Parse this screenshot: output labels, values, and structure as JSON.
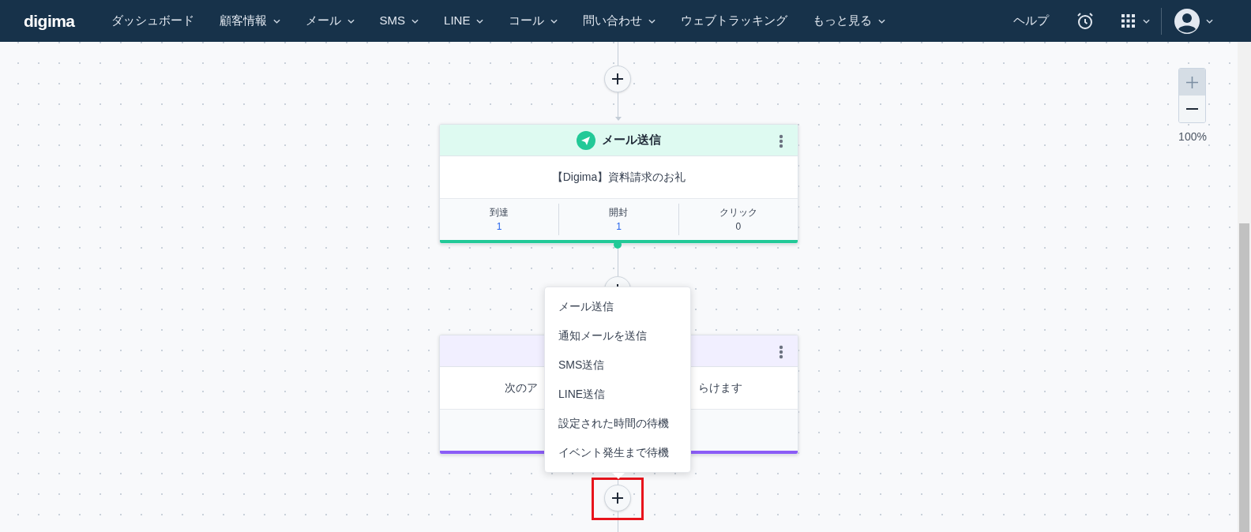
{
  "nav": {
    "logo": "digima",
    "items": [
      {
        "label": "ダッシュボード",
        "has_dropdown": false
      },
      {
        "label": "顧客情報",
        "has_dropdown": true
      },
      {
        "label": "メール",
        "has_dropdown": true
      },
      {
        "label": "SMS",
        "has_dropdown": true
      },
      {
        "label": "LINE",
        "has_dropdown": true
      },
      {
        "label": "コール",
        "has_dropdown": true
      },
      {
        "label": "問い合わせ",
        "has_dropdown": true
      },
      {
        "label": "ウェブトラッキング",
        "has_dropdown": false
      },
      {
        "label": "もっと見る",
        "has_dropdown": true
      }
    ],
    "help": "ヘルプ"
  },
  "nodes": [
    {
      "kind": "mail",
      "title": "メール送信",
      "subject": "【Digima】資料請求のお礼",
      "stats": [
        {
          "label": "到達",
          "value": "1",
          "linked": true
        },
        {
          "label": "開封",
          "value": "1",
          "linked": true
        },
        {
          "label": "クリック",
          "value": "0",
          "linked": false
        }
      ]
    },
    {
      "kind": "wait",
      "body_left": "次のア",
      "body_right": "らけます"
    }
  ],
  "add_menu": {
    "items": [
      "メール送信",
      "通知メールを送信",
      "SMS送信",
      "LINE送信",
      "設定された時間の待機",
      "イベント発生まで待機"
    ]
  },
  "zoom": {
    "level_text": "100%"
  }
}
